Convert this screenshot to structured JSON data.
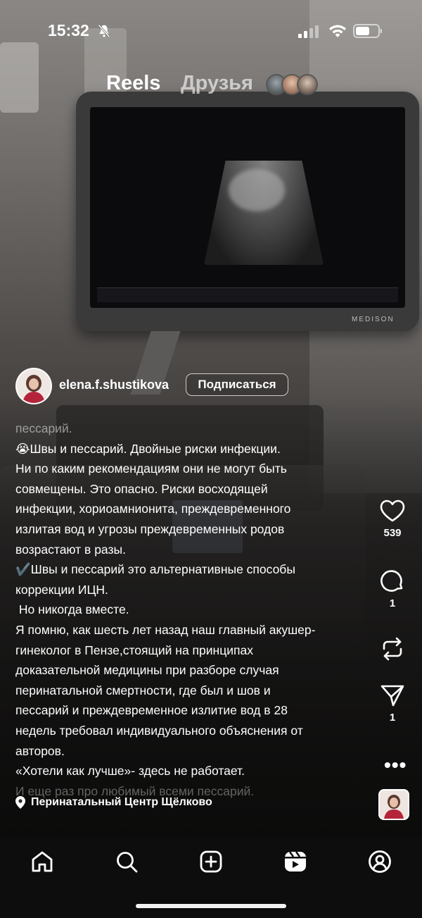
{
  "status_bar": {
    "time": "15:32"
  },
  "header": {
    "tab_reels": "Reels",
    "tab_friends": "Друзья"
  },
  "post": {
    "username": "elena.f.shustikova",
    "follow_label": "Подписаться",
    "caption_lines": [
      "пессарий.",
      "😭Швы и пессарий. Двойные риски инфекции.",
      "Ни по каким рекомендациям они не могут быть",
      "совмещены. Это опасно. Риски восходящей",
      "инфекции, хориоамнионита, преждевременного",
      "излитая вод и угрозы преждевременных родов",
      "возрастают в разы.",
      "✔️Швы и пессарий это альтернативные способы",
      "коррекции ИЦН.",
      " Но никогда вместе.",
      "Я помню, как шесть лет назад наш главный акушер-",
      "гинеколог в Пензе,стоящий на  принципах",
      "доказательной медицины при разборе случая",
      "перинатальной смертности, где был и шов и",
      "пессарий и преждевременное излитие вод в 28",
      "недель  требовал индивидуального объяснения от",
      "авторов.",
      "«Хотели как лучше»- здесь не работает.",
      "И еще раз про любимый всеми пессарий."
    ],
    "location": "Перинатальный Центр Щёлково",
    "likes": "539",
    "comments": "1",
    "shares": "1"
  },
  "icons": {
    "bell": "bell-slash-icon",
    "signal": "signal-icon",
    "wifi": "wifi-icon",
    "battery": "battery-icon",
    "like": "heart-icon",
    "comment": "comment-icon",
    "repost": "repost-icon",
    "share": "send-icon",
    "more": "more-icon",
    "location": "location-pin-icon",
    "nav": [
      "home-icon",
      "search-icon",
      "create-icon",
      "reels-icon",
      "profile-icon"
    ]
  },
  "colors": {
    "nav_bg": "#0d0d0d",
    "text": "#ffffff"
  }
}
